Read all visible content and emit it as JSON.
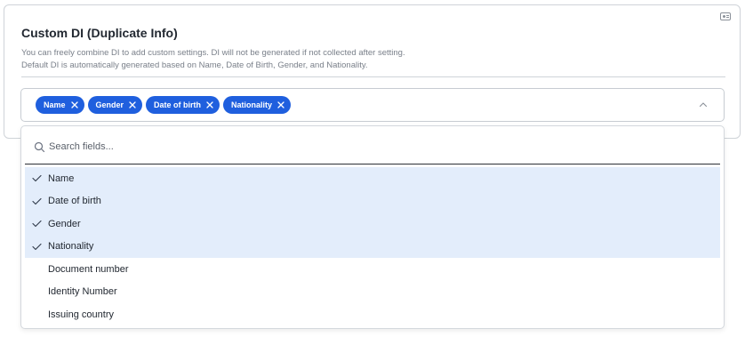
{
  "card": {
    "title": "Custom DI (Duplicate Info)",
    "description_line1": "You can freely combine DI to add custom settings. DI will not be generated if not collected after setting.",
    "description_line2": "Default DI is automatically generated based on Name, Date of Birth, Gender, and Nationality.",
    "icon": "id-card-icon"
  },
  "select": {
    "chips": [
      {
        "label": "Name"
      },
      {
        "label": "Gender"
      },
      {
        "label": "Date of birth"
      },
      {
        "label": "Nationality"
      }
    ],
    "chip_color": "#1f5fde",
    "expanded": true
  },
  "dropdown": {
    "search_placeholder": "Search fields...",
    "selected_bg": "#e3edfb",
    "options": [
      {
        "label": "Name",
        "selected": true
      },
      {
        "label": "Date of birth",
        "selected": true
      },
      {
        "label": "Gender",
        "selected": true
      },
      {
        "label": "Nationality",
        "selected": true
      },
      {
        "label": "Document number",
        "selected": false
      },
      {
        "label": "Identity Number",
        "selected": false
      },
      {
        "label": "Issuing country",
        "selected": false
      }
    ]
  }
}
